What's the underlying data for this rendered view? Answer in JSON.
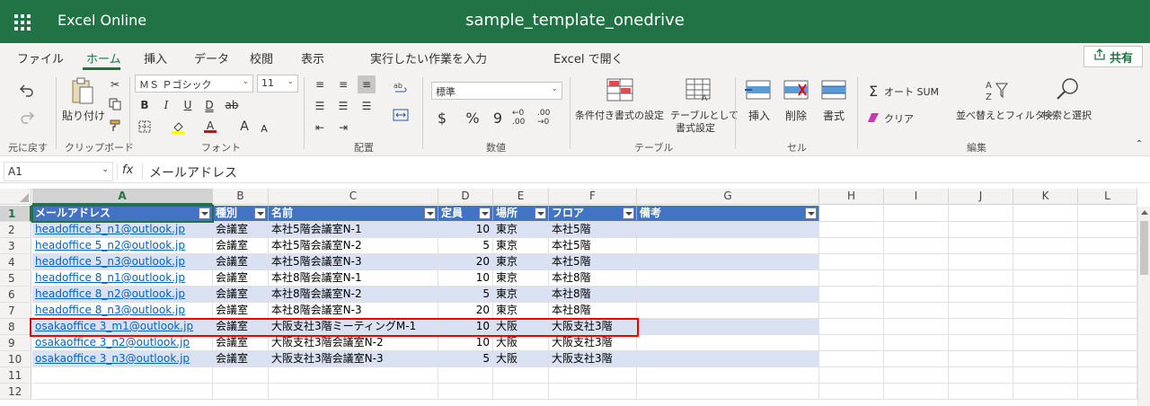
{
  "app": {
    "name": "Excel Online",
    "document": "sample_template_onedrive"
  },
  "tabs": [
    {
      "label": "ファイル"
    },
    {
      "label": "ホーム"
    },
    {
      "label": "挿入"
    },
    {
      "label": "データ"
    },
    {
      "label": "校閲"
    },
    {
      "label": "表示"
    },
    {
      "label": "実行したい作業を入力"
    },
    {
      "label": "Excel で開く"
    }
  ],
  "share": {
    "label": "共有"
  },
  "ribbon": {
    "undo_label": "元に戻す",
    "paste_label": "貼り付け",
    "clipboard_group": "クリップボード",
    "font_name": "ＭＳ Ｐゴシック",
    "font_size": "11",
    "font_group": "フォント",
    "bold": "B",
    "italic": "I",
    "underline": "U",
    "double_underline": "D",
    "strike": "ab",
    "grow_font": "A",
    "shrink_font": "A",
    "align_group": "配置",
    "number_format": "標準",
    "currency": "$",
    "percent": "%",
    "comma": "9",
    "inc_dec": "←0 .00",
    "dec_dec": ".00 →0",
    "number_group": "数値",
    "cond_format": "条件付き書式の設定",
    "table_format_1": "テーブルとして",
    "table_format_2": "書式設定",
    "table_group": "テーブル",
    "insert": "挿入",
    "delete": "削除",
    "format": "書式",
    "cells_group": "セル",
    "autosum": "オート SUM",
    "clear": "クリア",
    "sort_filter": "並べ替えとフィルター",
    "find_select": "検索と選択",
    "edit_group": "編集"
  },
  "formula_bar": {
    "name_box": "A1",
    "fx": "fx",
    "content": "メールアドレス"
  },
  "columns": [
    "A",
    "B",
    "C",
    "D",
    "E",
    "F",
    "G",
    "H",
    "I",
    "J",
    "K",
    "L"
  ],
  "rows": [
    "1",
    "2",
    "3",
    "4",
    "5",
    "6",
    "7",
    "8",
    "9",
    "10",
    "11",
    "12"
  ],
  "table": {
    "headers": [
      "メールアドレス",
      "種別",
      "名前",
      "定員",
      "場所",
      "フロア",
      "備考"
    ],
    "data": [
      [
        "headoffice 5_n1@outlook.jp",
        "会議室",
        "本社5階会議室N-1",
        "10",
        "東京",
        "本社5階",
        ""
      ],
      [
        "headoffice 5_n2@outlook.jp",
        "会議室",
        "本社5階会議室N-2",
        "5",
        "東京",
        "本社5階",
        ""
      ],
      [
        "headoffice 5_n3@outlook.jp",
        "会議室",
        "本社5階会議室N-3",
        "20",
        "東京",
        "本社5階",
        ""
      ],
      [
        "headoffice 8_n1@outlook.jp",
        "会議室",
        "本社8階会議室N-1",
        "10",
        "東京",
        "本社8階",
        ""
      ],
      [
        "headoffice 8_n2@outlook.jp",
        "会議室",
        "本社8階会議室N-2",
        "5",
        "東京",
        "本社8階",
        ""
      ],
      [
        "headoffice 8_n3@outlook.jp",
        "会議室",
        "本社8階会議室N-3",
        "20",
        "東京",
        "本社8階",
        ""
      ],
      [
        "osakaoffice 3_m1@outlook.jp",
        "会議室",
        "大阪支社3階ミーティングM-1",
        "10",
        "大阪",
        "大阪支社3階",
        ""
      ],
      [
        "osakaoffice 3_n2@outlook.jp",
        "会議室",
        "大阪支社3階会議室N-2",
        "10",
        "大阪",
        "大阪支社3階",
        ""
      ],
      [
        "osakaoffice 3_n3@outlook.jp",
        "会議室",
        "大阪支社3階会議室N-3",
        "5",
        "大阪",
        "大阪支社3階",
        ""
      ]
    ]
  }
}
